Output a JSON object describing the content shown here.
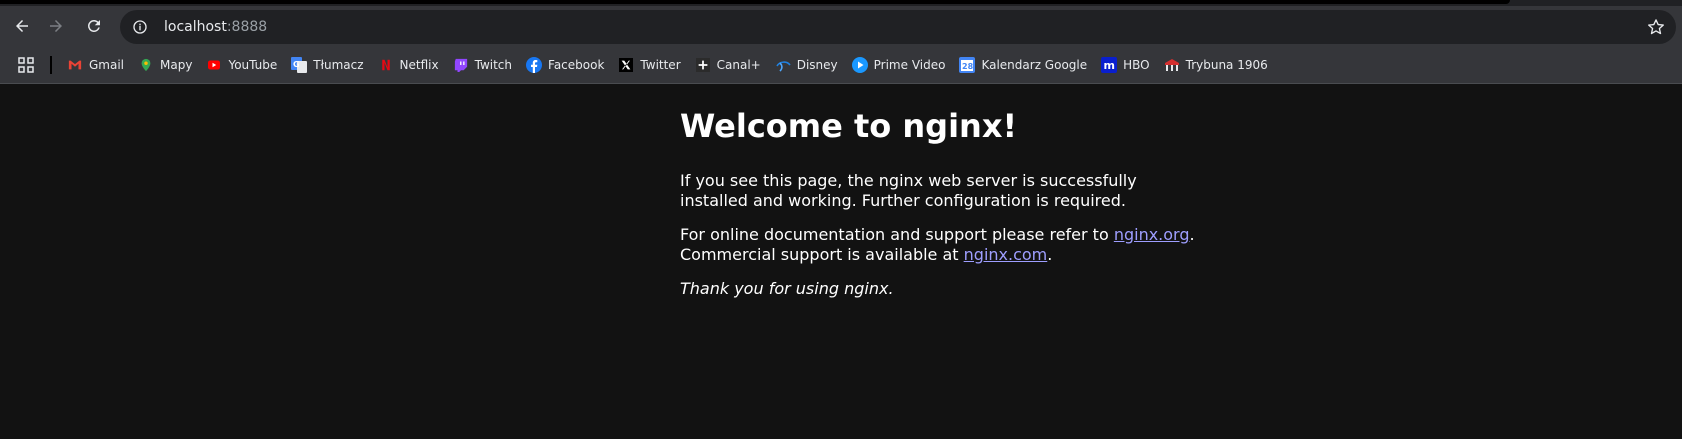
{
  "browser": {
    "url_host": "localhost",
    "url_port": ":8888"
  },
  "bookmarks": [
    {
      "label": "Gmail",
      "icon": "gmail-icon",
      "color": "#ea4335"
    },
    {
      "label": "Mapy",
      "icon": "maps-icon",
      "color": "#34a853"
    },
    {
      "label": "YouTube",
      "icon": "youtube-icon",
      "color": "#ff0000"
    },
    {
      "label": "Tłumacz",
      "icon": "translate-icon",
      "color": "#4285f4"
    },
    {
      "label": "Netflix",
      "icon": "netflix-icon",
      "color": "#e50914"
    },
    {
      "label": "Twitch",
      "icon": "twitch-icon",
      "color": "#9146ff"
    },
    {
      "label": "Facebook",
      "icon": "facebook-icon",
      "color": "#1877f2"
    },
    {
      "label": "Twitter",
      "icon": "x-icon",
      "color": "#000000"
    },
    {
      "label": "Canal+",
      "icon": "canal-plus-icon",
      "color": "#2b2b2b"
    },
    {
      "label": "Disney",
      "icon": "disney-icon",
      "color": "#1f80e0"
    },
    {
      "label": "Prime Video",
      "icon": "prime-video-icon",
      "color": "#1a98ff"
    },
    {
      "label": "Kalendarz Google",
      "icon": "google-calendar-icon",
      "color": "#4285f4",
      "glyph": "28"
    },
    {
      "label": "HBO",
      "icon": "hbo-icon",
      "color": "#0a1fce",
      "glyph": "m"
    },
    {
      "label": "Trybuna 1906",
      "icon": "trybuna-icon",
      "color": "#d32f2f"
    }
  ],
  "page": {
    "heading": "Welcome to nginx!",
    "para1": "If you see this page, the nginx web server is successfully installed and working. Further configuration is required.",
    "para2_prefix": "For online documentation and support please refer to ",
    "link1": "nginx.org",
    "para2_mid": ".",
    "para2_line2": "Commercial support is available at ",
    "link2": "nginx.com",
    "para2_end": ".",
    "thanks": "Thank you for using nginx."
  }
}
